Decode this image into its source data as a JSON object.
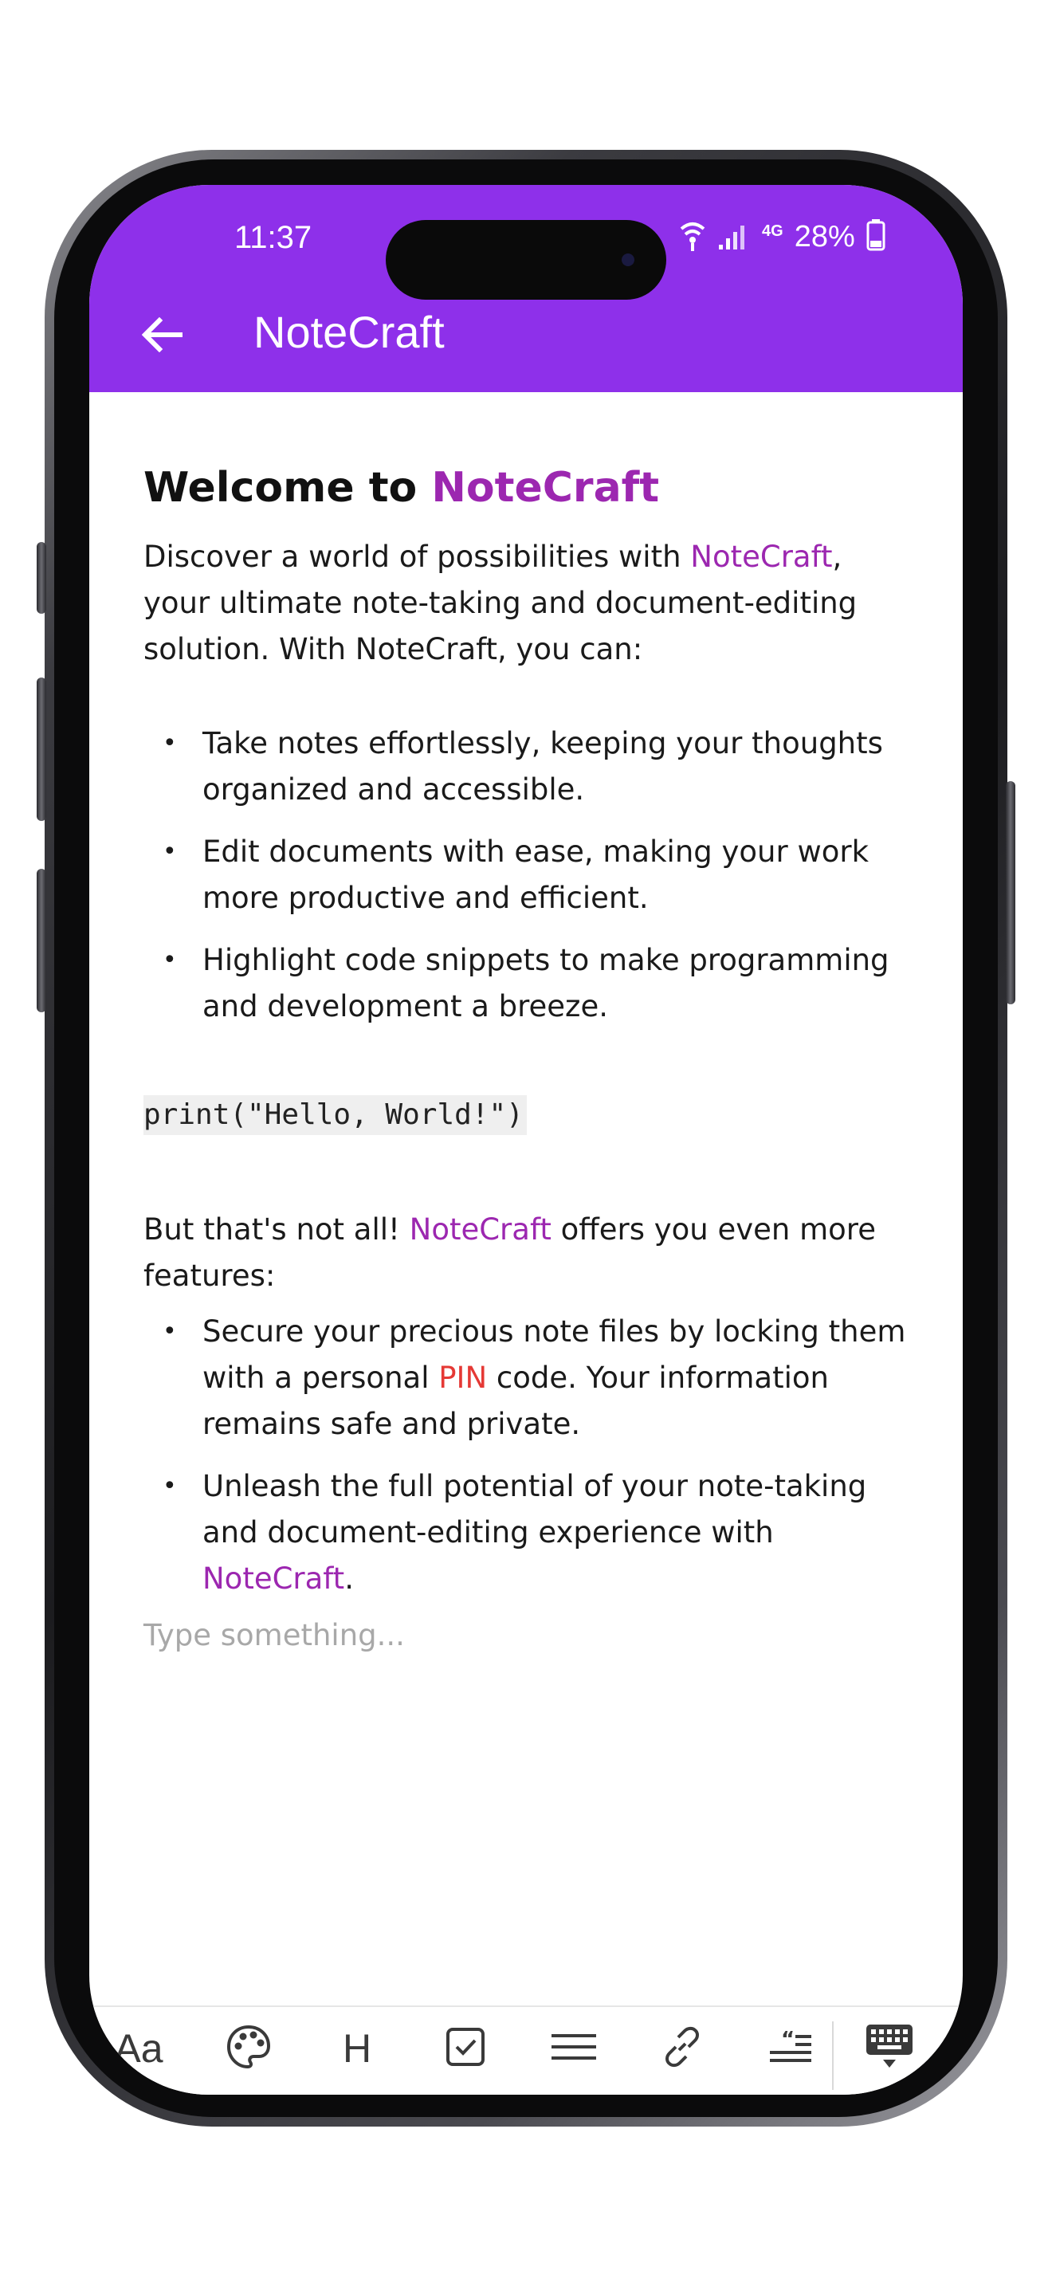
{
  "status_bar": {
    "time": "11:37",
    "network": "4G",
    "battery": "28%"
  },
  "app_bar": {
    "title": "NoteCraft",
    "back_icon": "arrow-left-icon",
    "color": "#8e30ea"
  },
  "document": {
    "heading_prefix": "Welcome to ",
    "heading_brand": "NoteCraft",
    "intro_a": "Discover a world of possibilities with ",
    "intro_brand": "NoteCraft",
    "intro_b": ", your ultimate note-taking and document-editing solution. With NoteCraft, you can:",
    "bullets_1": [
      "Take notes effortlessly, keeping your thoughts organized and accessible.",
      "Edit documents with ease, making your work more productive and efficient.",
      "Highlight code snippets to make programming and development a breeze."
    ],
    "code": "print(\"Hello, World!\")",
    "more_a": "But that's not all! ",
    "more_brand": "NoteCraft",
    "more_b": " offers you even more features:",
    "bullet_pin_a": "Secure your precious note files by locking them with a personal ",
    "bullet_pin_highlight": "PIN",
    "bullet_pin_b": " code. Your information remains safe and private.",
    "bullet_last_a": "Unleash the full potential of your note-taking and document-editing experience with ",
    "bullet_last_brand": "NoteCraft",
    "bullet_last_b": ".",
    "placeholder": "Type something..."
  },
  "toolbar": {
    "text_style_label": "Aa",
    "heading_label": "H",
    "icons": [
      "text-style-icon",
      "palette-icon",
      "heading-icon",
      "checkbox-icon",
      "align-icon",
      "link-icon",
      "quote-icon",
      "keyboard-icon"
    ]
  },
  "colors": {
    "brand_text": "#9c27b0",
    "pin_text": "#e53935"
  }
}
